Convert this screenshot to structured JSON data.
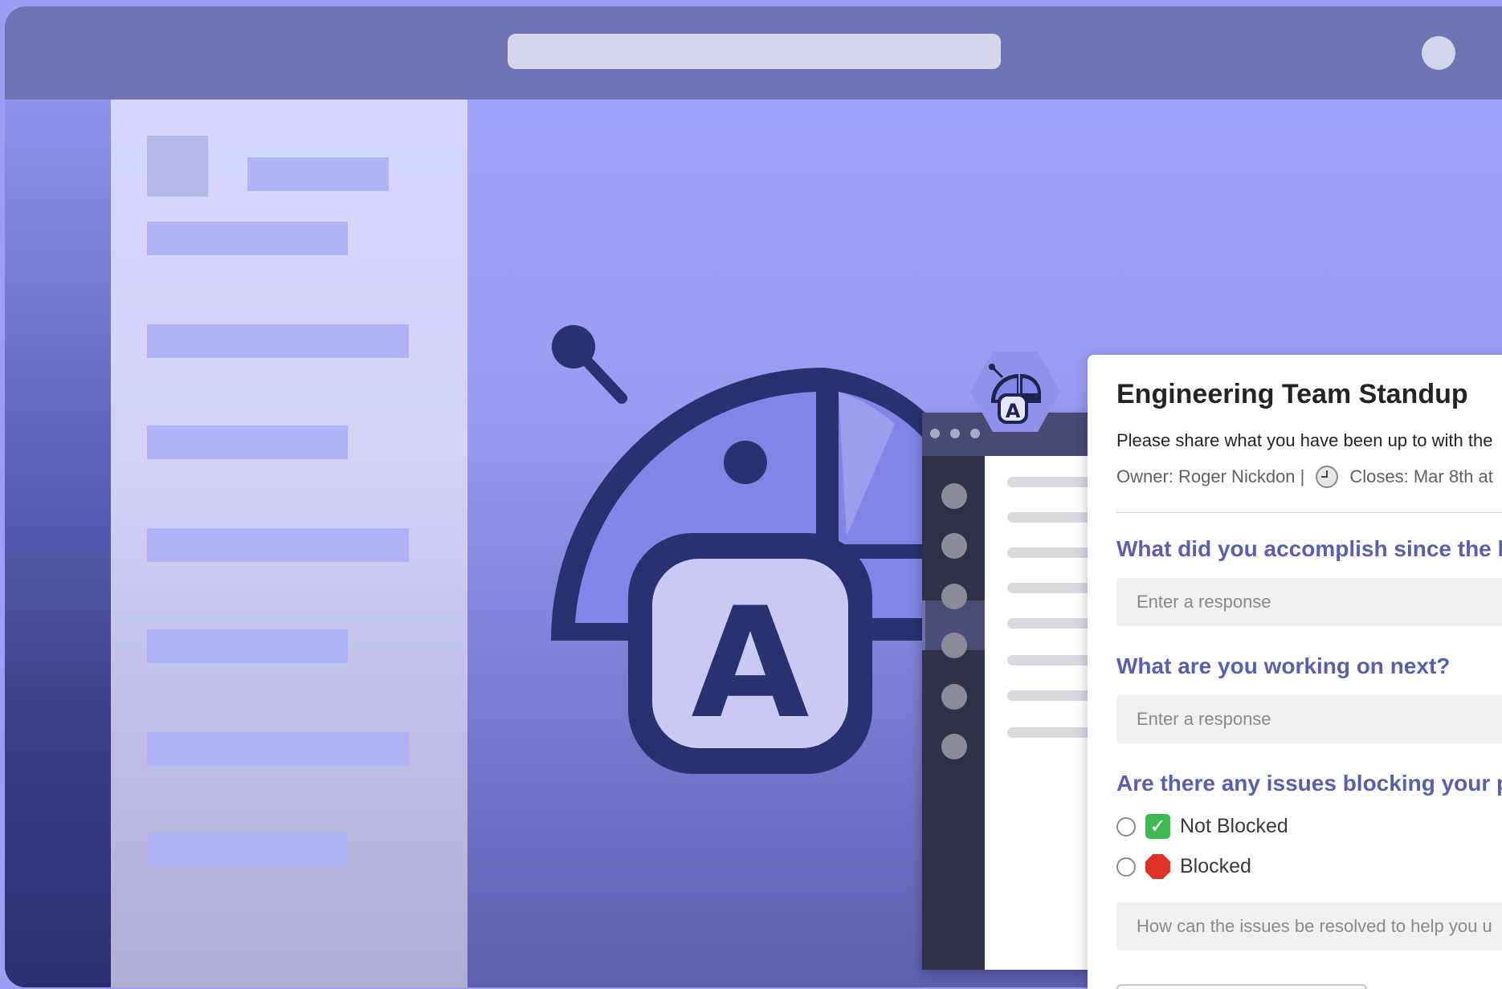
{
  "card": {
    "title": "Engineering Team Standup",
    "description": "Please share what you have been up to with the",
    "owner": "Owner: Roger Nickdon |",
    "closes": "Closes: Mar 8th at",
    "questions": [
      "What did you accomplish since the las",
      "What are you working on next?",
      "Are there any issues blocking your pro"
    ],
    "placeholders": [
      "Enter a response",
      "Enter a response",
      "How can the issues be resolved to help you u"
    ],
    "options": [
      "Not Blocked",
      "Blocked"
    ]
  },
  "mascot_letter": "A",
  "colors": {
    "background": "#9b9ef3",
    "titlebar": "#6f74b4",
    "accent": "#5b5fa8",
    "mascot_dark": "#293270",
    "mascot_light": "#c9c9f3"
  },
  "icons": [
    "clock-icon",
    "check-mark-emoji-icon",
    "stop-sign-emoji-icon",
    "mascot-logo-icon"
  ]
}
